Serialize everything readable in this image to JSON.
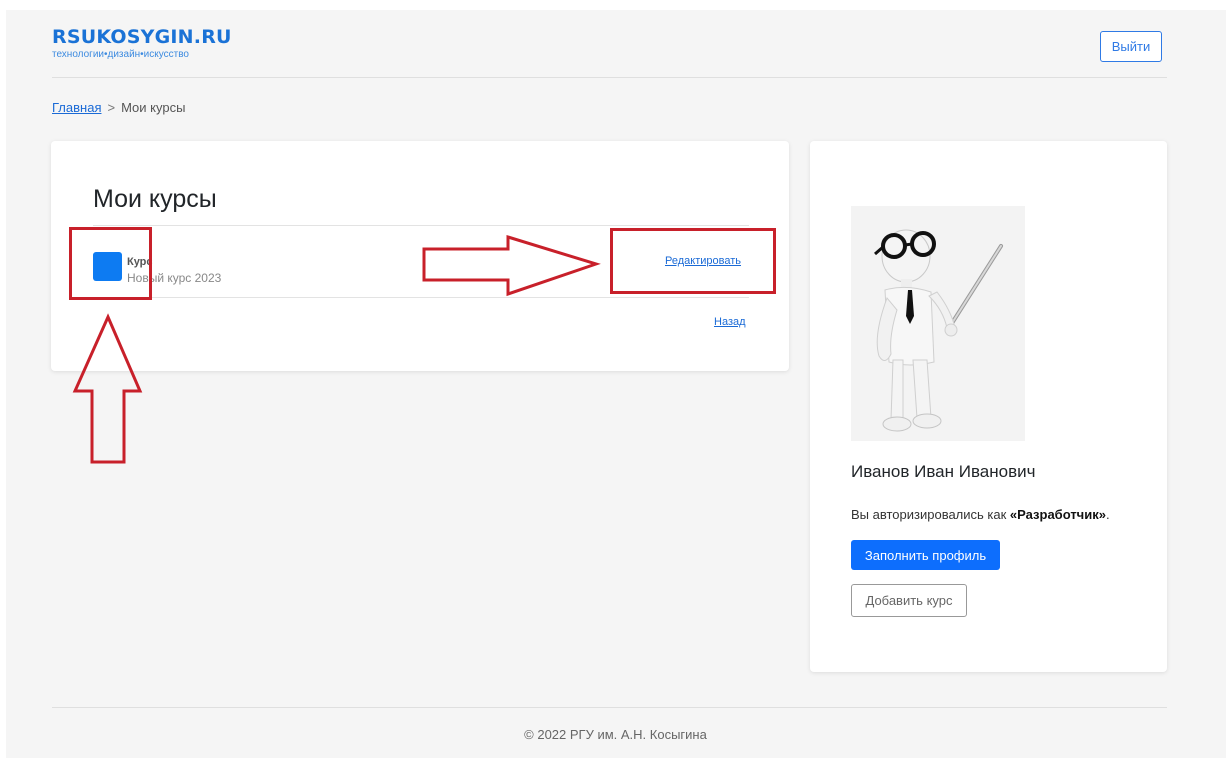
{
  "header": {
    "logo_title": "RSUKOSYGIN.RU",
    "logo_tagline": "технологии•дизайн•искусство",
    "logout_label": "Выйти"
  },
  "breadcrumb": {
    "home": "Главная",
    "separator": ">",
    "current": "Мои курсы"
  },
  "courses": {
    "title": "Мои курсы",
    "items": [
      {
        "name": "Курс",
        "subtitle": "Новый курс 2023",
        "icon_color": "#0d7bf2",
        "action_label": "Редактировать"
      }
    ],
    "back_label": "Назад"
  },
  "profile": {
    "avatar_icon": "teacher-figure-with-pointer",
    "name": "Иванов Иван Иванович",
    "auth_prefix": "Вы авторизировались как ",
    "role": "«Разработчик»",
    "auth_suffix": ".",
    "fill_profile_label": "Заполнить профиль",
    "add_course_label": "Добавить курс"
  },
  "footer": {
    "copyright": "© 2022 РГУ им. А.Н. Косыгина"
  },
  "colors": {
    "accent": "#0d6efd",
    "brand": "#1a72d6",
    "annotation": "#c8202a"
  }
}
